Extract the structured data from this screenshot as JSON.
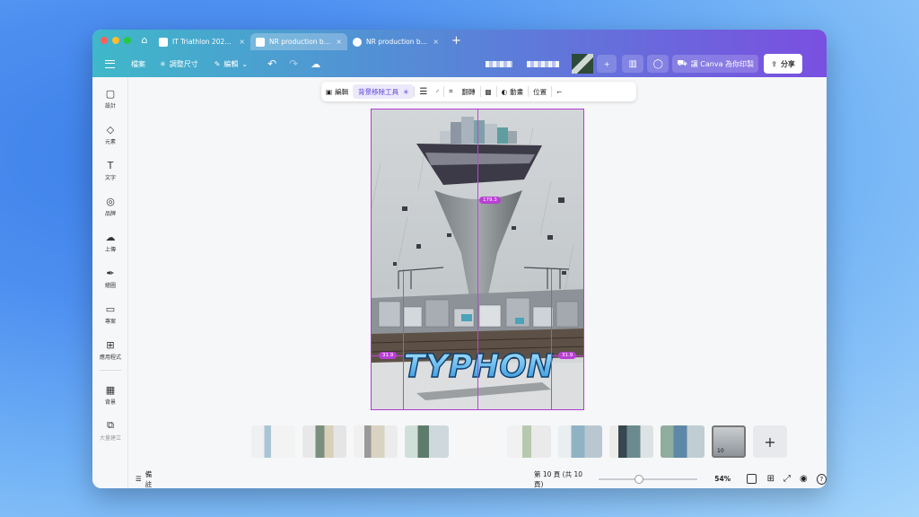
{
  "browser": {
    "tabs": [
      {
        "title": "IT Triathlon 2024 - ...",
        "active": false
      },
      {
        "title": "NR production bro...",
        "active": true
      },
      {
        "title": "NR production bro...",
        "active": false
      }
    ],
    "close_glyph": "×",
    "new_tab_glyph": "+"
  },
  "toolbar": {
    "file_label": "檔案",
    "resize_label": "調整尺寸",
    "edit_label": "編輯",
    "print_label": "讓 Canva 為你印製",
    "share_label": "分享"
  },
  "sidebar": {
    "items": [
      {
        "label": "設計",
        "icon": "layout-icon"
      },
      {
        "label": "元素",
        "icon": "shapes-icon"
      },
      {
        "label": "文字",
        "icon": "text-icon"
      },
      {
        "label": "品牌",
        "icon": "brand-icon"
      },
      {
        "label": "上傳",
        "icon": "upload-cloud-icon"
      },
      {
        "label": "繪圖",
        "icon": "draw-pen-icon"
      },
      {
        "label": "專案",
        "icon": "folder-icon"
      },
      {
        "label": "應用程式",
        "icon": "apps-icon"
      },
      {
        "label": "背景",
        "icon": "background-icon"
      },
      {
        "label": "大量建立",
        "icon": "bulk-create-icon"
      }
    ]
  },
  "context_toolbar": {
    "edit_label": "編輯",
    "bg_remove_label": "背景移除工具",
    "flip_label": "翻轉",
    "animate_label": "動畫",
    "position_label": "位置"
  },
  "canvas": {
    "poster_title": "TYPHON",
    "measure_top": "179.3",
    "measure_left": "31.9",
    "measure_right": "31.9"
  },
  "filmstrip": {
    "selected_page_number": "10",
    "add_page_glyph": "+"
  },
  "status": {
    "notes_label": "備註",
    "page_indicator": "第 10 頁 (共 10 頁)",
    "zoom": "54%",
    "zoom_fraction": 0.41
  },
  "colors": {
    "selection": "#c044d6",
    "accent": "#6e5ae6"
  }
}
